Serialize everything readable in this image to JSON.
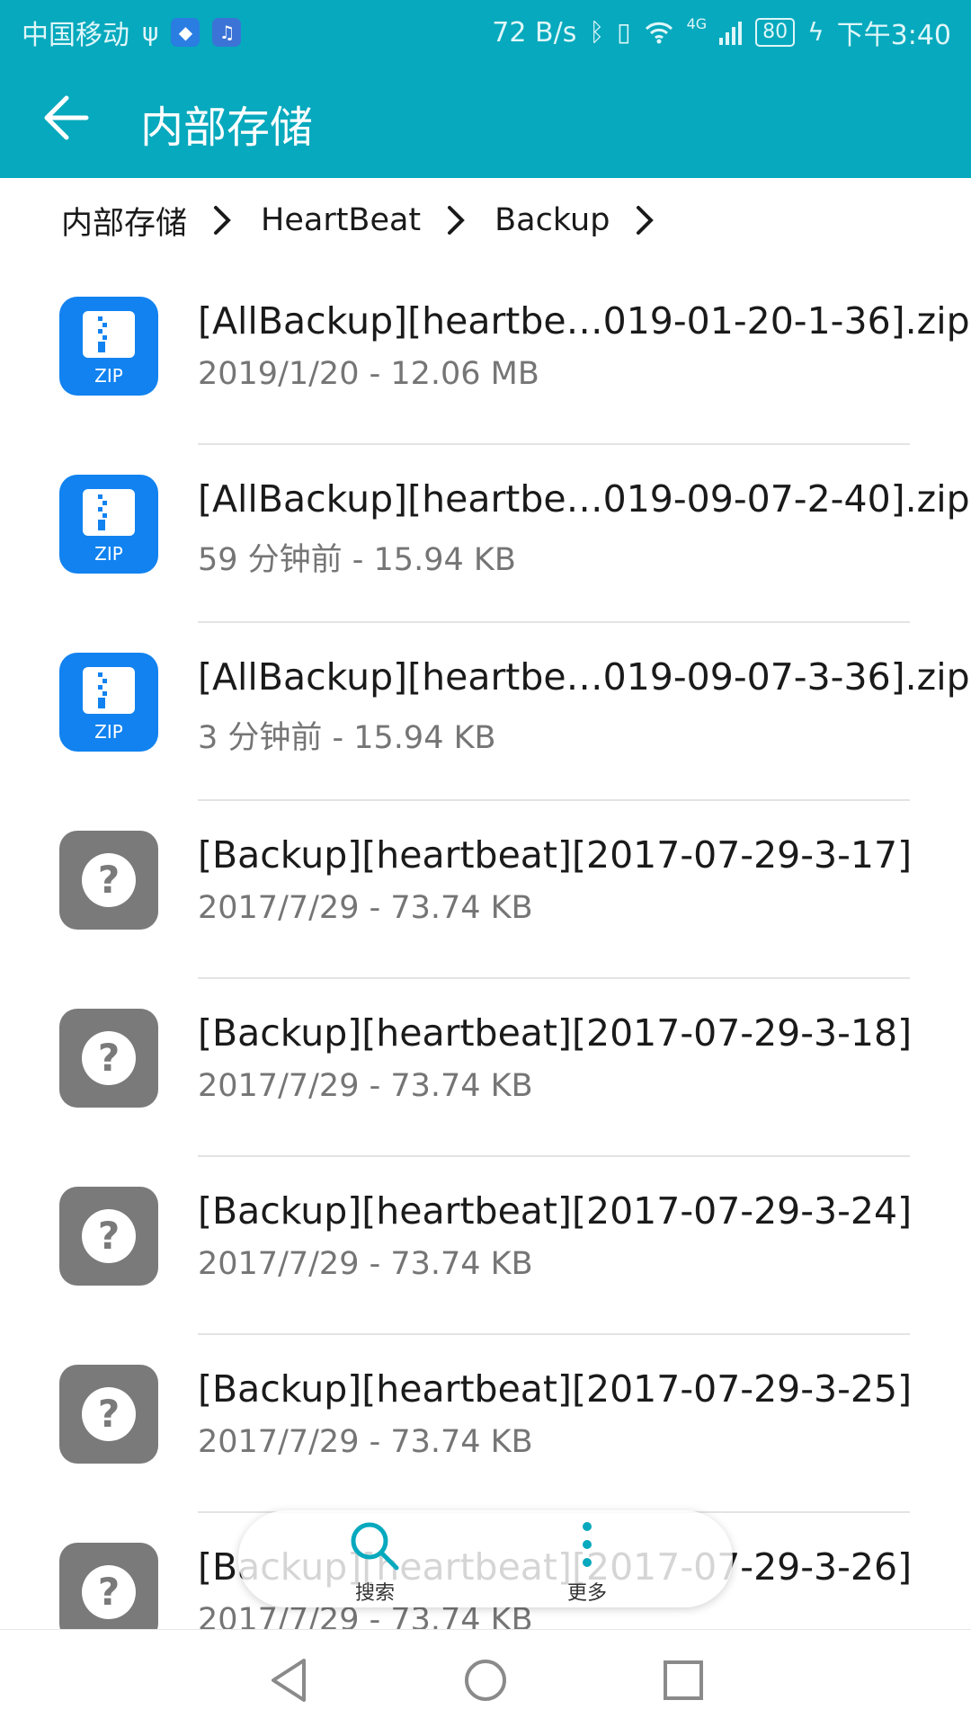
{
  "status_bar": {
    "carrier": "中国移动",
    "net_speed": "72 B/s",
    "signal_tag": "4G",
    "battery": "80",
    "time": "下午3:40"
  },
  "app_bar": {
    "title": "内部存储"
  },
  "breadcrumb": [
    "内部存储",
    "HeartBeat",
    "Backup"
  ],
  "files": [
    {
      "name": "[AllBackup][heartbe…019-01-20-1-36].zip",
      "meta": "2019/1/20 - 12.06 MB",
      "type": "zip",
      "icon_label": "ZIP"
    },
    {
      "name": "[AllBackup][heartbe…019-09-07-2-40].zip",
      "meta": "59 分钟前 - 15.94 KB",
      "type": "zip",
      "icon_label": "ZIP"
    },
    {
      "name": "[AllBackup][heartbe…019-09-07-3-36].zip",
      "meta": "3 分钟前 - 15.94 KB",
      "type": "zip",
      "icon_label": "ZIP"
    },
    {
      "name": "[Backup][heartbeat][2017-07-29-3-17]",
      "meta": "2017/7/29 - 73.74 KB",
      "type": "unknown",
      "icon_label": ""
    },
    {
      "name": "[Backup][heartbeat][2017-07-29-3-18]",
      "meta": "2017/7/29 - 73.74 KB",
      "type": "unknown",
      "icon_label": ""
    },
    {
      "name": "[Backup][heartbeat][2017-07-29-3-24]",
      "meta": "2017/7/29 - 73.74 KB",
      "type": "unknown",
      "icon_label": ""
    },
    {
      "name": "[Backup][heartbeat][2017-07-29-3-25]",
      "meta": "2017/7/29 - 73.74 KB",
      "type": "unknown",
      "icon_label": ""
    },
    {
      "name": "[Backup][heartbeat][2017-07-29-3-26]",
      "meta": "2017/7/29 - 73.74 KB",
      "type": "unknown",
      "icon_label": ""
    }
  ],
  "bottom_actions": {
    "search_label": "搜索",
    "more_label": "更多"
  },
  "colors": {
    "accent": "#06a9bd",
    "zip_icon": "#1182f0",
    "unknown_icon": "#7a7a7a"
  }
}
